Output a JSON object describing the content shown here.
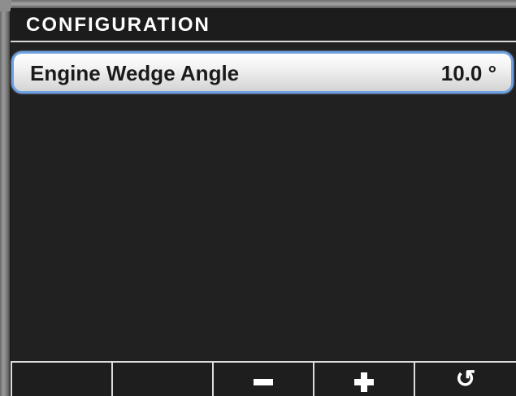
{
  "header": {
    "title": "CONFIGURATION"
  },
  "list": {
    "items": [
      {
        "label": "Engine Wedge Angle",
        "value": "10.0 °",
        "selected": true
      }
    ]
  },
  "softkeys": [
    {
      "label": "",
      "icon": "blank"
    },
    {
      "label": "",
      "icon": "blank"
    },
    {
      "label": "",
      "icon": "minus-icon"
    },
    {
      "label": "",
      "icon": "plus-icon"
    },
    {
      "label": "↺",
      "icon": "reset-icon"
    }
  ],
  "colors": {
    "background": "#212121",
    "header_text": "#ffffff",
    "selection_border": "#6fa2e2",
    "row_text": "#1a1a1a"
  }
}
